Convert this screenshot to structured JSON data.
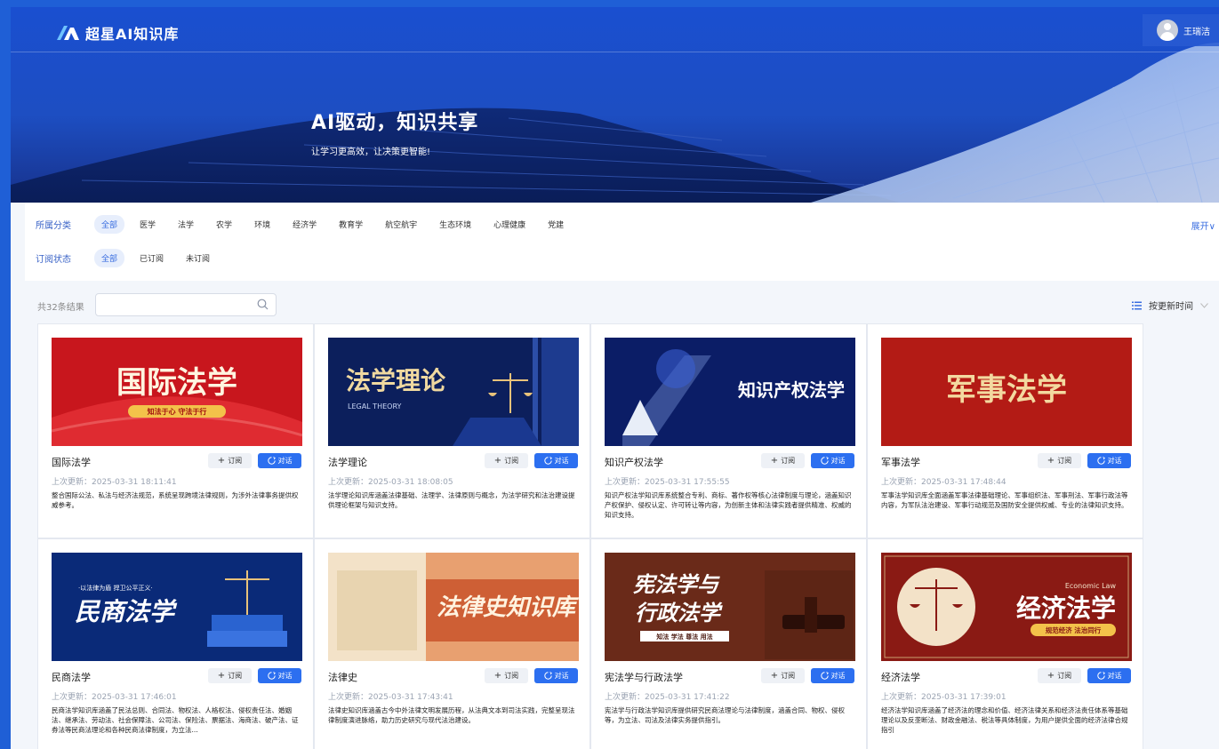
{
  "brand": {
    "name": "超星AI知识库"
  },
  "user": {
    "name": "王瑞洁"
  },
  "hero": {
    "title": "AI驱动，知识共享",
    "subtitle": "让学习更高效，让决策更智能!"
  },
  "filters": {
    "category_label": "所属分类",
    "categories": [
      "全部",
      "医学",
      "法学",
      "农学",
      "环境",
      "经济学",
      "教育学",
      "航空航宇",
      "生态环境",
      "心理健康",
      "党建"
    ],
    "status_label": "订阅状态",
    "statuses": [
      "全部",
      "已订阅",
      "未订阅"
    ],
    "expand_label": "展开"
  },
  "results": {
    "count_text": "共32条结果",
    "search_placeholder": "",
    "sort_label": "按更新时间"
  },
  "buttons": {
    "subscribe": "订阅",
    "chat": "对话"
  },
  "cards": [
    {
      "title": "国际法学",
      "updated": "上次更新：2025-03-31 18:11:41",
      "desc": "整合国际公法、私法与经济法规范，系统呈现跨境法律规则，为涉外法律事务提供权威参考。",
      "thumb_text": "国际法学",
      "thumb_sub": "知法于心 守法于行",
      "colors": {
        "bg1": "#c8161d",
        "bg2": "#e8343a",
        "text": "#fff5e0"
      }
    },
    {
      "title": "法学理论",
      "updated": "上次更新：2025-03-31 18:08:05",
      "desc": "法学理论知识库涵盖法律基础、法理学、法律原则与概念，为法学研究和法治建设提供理论框架与知识支持。",
      "thumb_text": "法学理论",
      "thumb_sub": "LEGAL THEORY",
      "colors": {
        "bg1": "#0c1f5c",
        "bg2": "#2a4fb0",
        "text": "#f0d9a0"
      }
    },
    {
      "title": "知识产权法学",
      "updated": "上次更新：2025-03-31 17:55:55",
      "desc": "知识产权法学知识库系统整合专利、商标、著作权等核心法律制度与理论，涵盖知识产权保护、侵权认定、许可转让等内容，为创新主体和法律实践者提供精准、权威的知识支持。",
      "thumb_text": "知识产权法学",
      "thumb_sub": "",
      "colors": {
        "bg1": "#0b1d66",
        "bg2": "#2745b8",
        "text": "#ffffff"
      }
    },
    {
      "title": "军事法学",
      "updated": "上次更新：2025-03-31 17:48:44",
      "desc": "军事法学知识库全面涵盖军事法律基础理论、军事组织法、军事刑法、军事行政法等内容，为军队法治建设、军事行动规范及国防安全提供权威、专业的法律知识支持。",
      "thumb_text": "军事法学",
      "thumb_sub": "",
      "colors": {
        "bg1": "#a8120f",
        "bg2": "#c42a1e",
        "text": "#f3d9a0"
      }
    },
    {
      "title": "民商法学",
      "updated": "上次更新：2025-03-31 17:46:01",
      "desc": "民商法学知识库涵盖了民法总则、合同法、物权法、人格权法、侵权责任法、婚姻法、继承法、劳动法、社会保障法、公司法、保险法、票据法、海商法、破产法、证券法等民商法理论和各种民商法律制度，为立法...",
      "thumb_text": "民商法学",
      "thumb_sub": "·以法律为盾 捍卫公平正义·",
      "colors": {
        "bg1": "#0a2a78",
        "bg2": "#2a63d0",
        "text": "#ffffff"
      }
    },
    {
      "title": "法律史",
      "updated": "上次更新：2025-03-31 17:43:41",
      "desc": "法律史知识库涵盖古今中外法律文明发展历程，从法典文本到司法实践，完整呈现法律制度演进脉络，助力历史研究与现代法治建设。",
      "thumb_text": "法律史知识库",
      "thumb_sub": "",
      "colors": {
        "bg1": "#c9542a",
        "bg2": "#e8a070",
        "text": "#fff3e0"
      }
    },
    {
      "title": "宪法学与行政法学",
      "updated": "上次更新：2025-03-31 17:41:22",
      "desc": "宪法学与行政法学知识库提供研究民商法理论与法律制度，涵盖合同、物权、侵权等，为立法、司法及法律实务提供指引。",
      "thumb_text": "宪法学与行政法学",
      "thumb_sub": "知法 学法 尊法 用法",
      "colors": {
        "bg1": "#4a1a10",
        "bg2": "#8a3a22",
        "text": "#ffffff"
      }
    },
    {
      "title": "经济法学",
      "updated": "上次更新：2025-03-31 17:39:01",
      "desc": "经济法学知识库涵盖了经济法的理念和价值、经济法律关系和经济法责任体系等基础理论以及反垄断法、财政金融法、税法等具体制度，为用户提供全面的经济法律合规指引",
      "thumb_text": "经济法学",
      "thumb_sub": "规范经济 法治同行",
      "thumb_top": "Economic Law",
      "colors": {
        "bg1": "#8a1a14",
        "bg2": "#a8322a",
        "text": "#ffffff"
      }
    }
  ]
}
